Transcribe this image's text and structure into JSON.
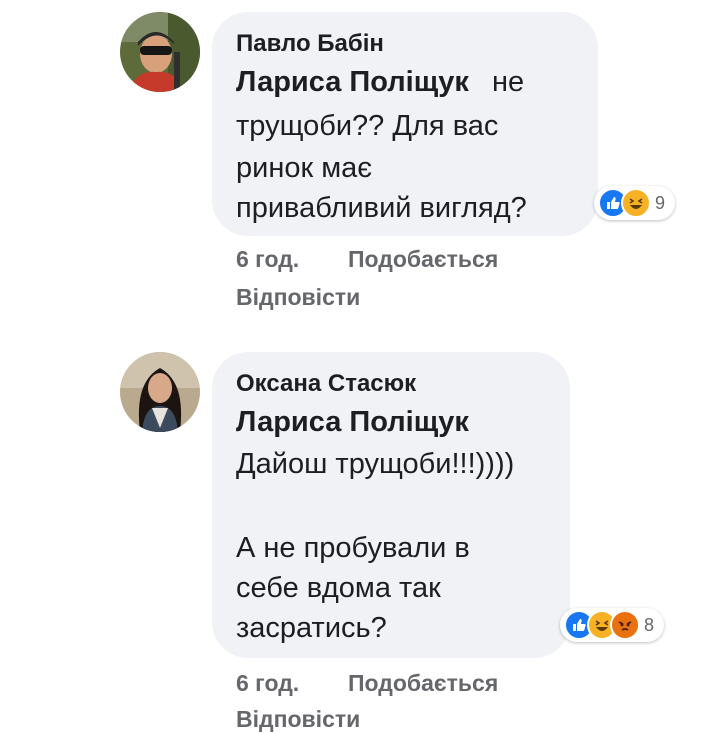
{
  "comments": [
    {
      "author": "Павло Бабін",
      "mention": "Лариса Поліщук",
      "lines": [
        "не",
        "трущоби?? Для вас",
        "ринок має",
        "привабливий вигляд?"
      ],
      "reaction_count": "9",
      "reactions": [
        "like-icon",
        "haha-icon"
      ],
      "time": "6 год.",
      "like_label": "Подобається",
      "reply_label": "Відповісти"
    },
    {
      "author": "Оксана Стасюк",
      "mention": "Лариса Поліщук",
      "lines": [
        "Дайош трущоби!!!))))",
        "А не пробували в",
        "себе вдома так",
        "засратись?"
      ],
      "reaction_count": "8",
      "reactions": [
        "like-icon",
        "haha-icon",
        "angry-icon"
      ],
      "time": "6 год.",
      "like_label": "Подобається",
      "reply_label": "Відповісти"
    }
  ],
  "colors": {
    "bubble": "#f0f2f5",
    "text": "#1c1e21",
    "meta": "#65676b",
    "like": "#1877f2",
    "haha": "#f7b125",
    "angry": "#e9710f"
  }
}
